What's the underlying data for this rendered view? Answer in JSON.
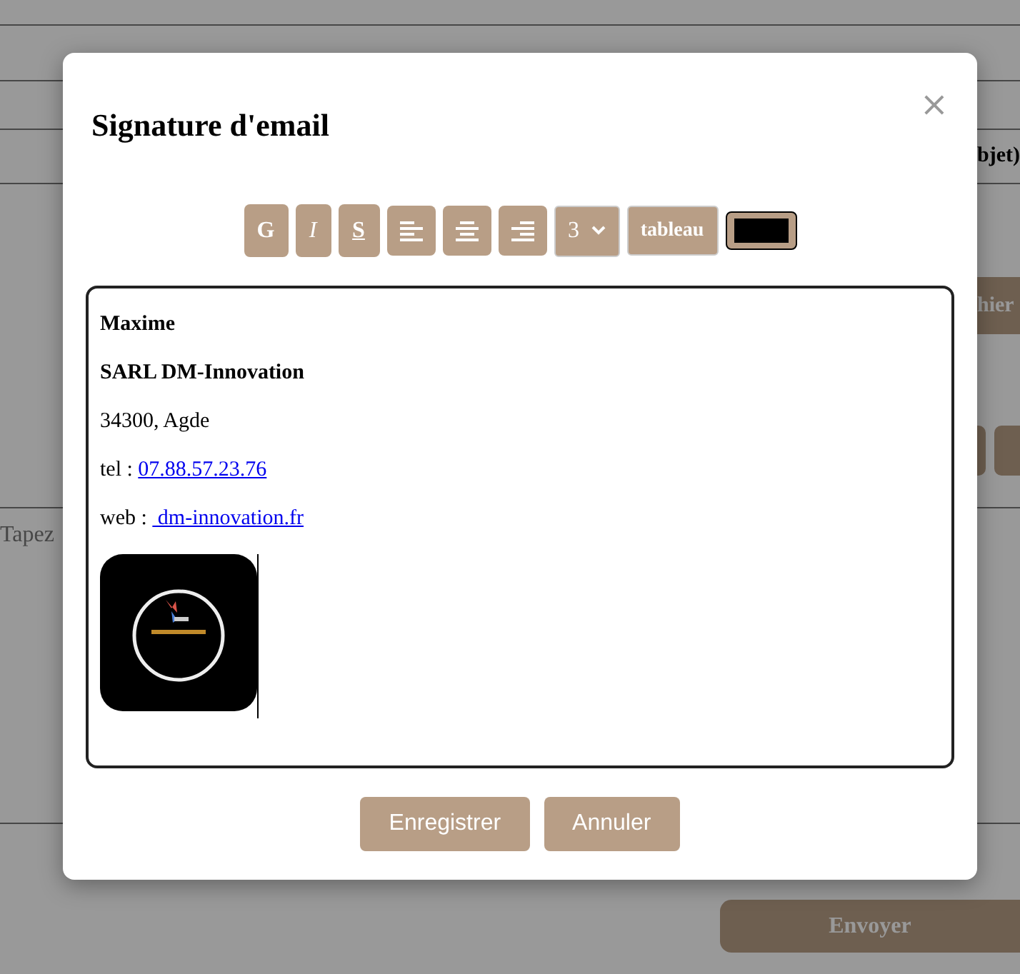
{
  "background": {
    "subject_header": "bjet)",
    "file_button": "hier",
    "message_placeholder": "Tapez",
    "send_button": "Envoyer"
  },
  "modal": {
    "title": "Signature d'email",
    "close": "×",
    "toolbar": [
      {
        "kind": "bold",
        "label": "G"
      },
      {
        "kind": "italic",
        "label": "I"
      },
      {
        "kind": "strike",
        "label": "S"
      },
      {
        "kind": "align-left"
      },
      {
        "kind": "align-center"
      },
      {
        "kind": "align-right"
      },
      {
        "kind": "select",
        "label": "3"
      },
      {
        "kind": "text",
        "label": "tableau"
      },
      {
        "kind": "color",
        "color": "#000000"
      }
    ],
    "editor": [
      {
        "kind": "bold",
        "text": "Maxime"
      },
      {
        "kind": "bold",
        "text": "SARL DM-Innovation"
      },
      {
        "kind": "plain",
        "text": "34300, Agde"
      },
      {
        "kind": "link",
        "text": "tel : ",
        "link": "07.88.57.23.76"
      },
      {
        "kind": "link",
        "text": "web : ",
        "link": " dm-innovation.fr"
      },
      {
        "kind": "picture"
      }
    ],
    "buttons": [
      "Enregistrer",
      "Annuler"
    ]
  }
}
